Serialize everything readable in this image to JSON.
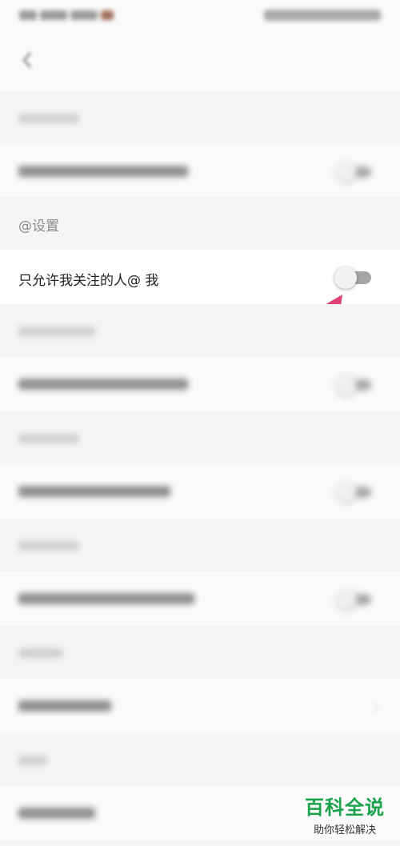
{
  "status_bar": {
    "left": "",
    "right": ""
  },
  "header": {
    "title": ""
  },
  "sections": [
    {
      "label": "",
      "item": "",
      "control": "toggle"
    },
    {
      "label": "@设置",
      "item": "只允许我关注的人@ 我",
      "control": "toggle",
      "toggle_on": false
    },
    {
      "label": "",
      "item": "",
      "control": "toggle"
    },
    {
      "label": "",
      "item": "",
      "control": "toggle"
    },
    {
      "label": "",
      "item": "",
      "control": "toggle"
    },
    {
      "label": "",
      "item": "",
      "control": "chevron"
    },
    {
      "label": "",
      "item": "",
      "control": "none"
    }
  ],
  "colors": {
    "arrow": "#e2407a",
    "toggle_track": "#a6a6a6",
    "watermark": "#1aa34a"
  },
  "watermark": {
    "title": "百科全说",
    "subtitle": "助你轻松解决"
  }
}
